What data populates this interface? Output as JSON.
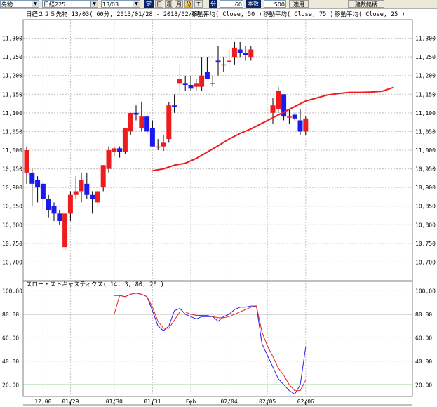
{
  "toolbar": {
    "market": "先物",
    "index": "日経225",
    "contract": "13/03",
    "fixed_label": "定",
    "periods": [
      {
        "label": "日",
        "active": false
      },
      {
        "label": "週",
        "active": false
      },
      {
        "label": "月",
        "active": false
      },
      {
        "label": "分",
        "active": true
      },
      {
        "label": "T",
        "active": false
      }
    ],
    "minute_label": "分",
    "minute_value": "60",
    "count_label": "本数",
    "count_value": "500",
    "apply_label": "適用",
    "brand_button": "建数銘柄"
  },
  "chart_header": {
    "title": "日経２２５先物 13/03( 60分, 2013/01/28 - 2013/02/07 )",
    "ma_labels": [
      "移動平均( Close, 50 )",
      "移動平均( Close, 75 )",
      "移動平均( Close, 25 )"
    ]
  },
  "colors": {
    "up": "#ee1c1c",
    "down": "#1a1aee",
    "ma": "#ee1c1c",
    "grid": "#c0c0c0",
    "stoch_k": "#2222ee",
    "stoch_d": "#ee2222",
    "ref_high": "#999999",
    "ref_low": "#33aa33"
  },
  "chart_data": [
    {
      "type": "candlestick",
      "ylim": [
        10650,
        11350
      ],
      "y_ticks": [
        "11,300",
        "11,250",
        "11,200",
        "11,150",
        "11,100",
        "11,050",
        "11,000",
        "10,950",
        "10,900",
        "10,850",
        "10,800",
        "10,750",
        "10,700"
      ],
      "x_ticks": [
        {
          "label": "12:00",
          "index": 3
        },
        {
          "label": "01/29",
          "index": 8
        },
        {
          "label": "01/30",
          "index": 16
        },
        {
          "label": "01/31",
          "index": 23
        },
        {
          "label": "Feb",
          "index": 30
        },
        {
          "label": "02/04",
          "index": 37
        },
        {
          "label": "02/05",
          "index": 44
        },
        {
          "label": "02/06",
          "index": 51
        }
      ],
      "candles": [
        {
          "o": 10940,
          "h": 11010,
          "l": 10910,
          "c": 11000
        },
        {
          "o": 10940,
          "h": 10950,
          "l": 10850,
          "c": 10910
        },
        {
          "o": 10920,
          "h": 10930,
          "l": 10860,
          "c": 10900
        },
        {
          "o": 10910,
          "h": 10920,
          "l": 10840,
          "c": 10870
        },
        {
          "o": 10870,
          "h": 10880,
          "l": 10820,
          "c": 10840
        },
        {
          "o": 10850,
          "h": 10860,
          "l": 10810,
          "c": 10830
        },
        {
          "o": 10830,
          "h": 10840,
          "l": 10800,
          "c": 10810
        },
        {
          "o": 10740,
          "h": 10830,
          "l": 10730,
          "c": 10830
        },
        {
          "o": 10830,
          "h": 10890,
          "l": 10810,
          "c": 10880
        },
        {
          "o": 10880,
          "h": 10930,
          "l": 10870,
          "c": 10890
        },
        {
          "o": 10890,
          "h": 10940,
          "l": 10860,
          "c": 10920
        },
        {
          "o": 10910,
          "h": 10940,
          "l": 10870,
          "c": 10880
        },
        {
          "o": 10880,
          "h": 10890,
          "l": 10830,
          "c": 10870
        },
        {
          "o": 10860,
          "h": 10890,
          "l": 10850,
          "c": 10890
        },
        {
          "o": 10900,
          "h": 10960,
          "l": 10890,
          "c": 10960
        },
        {
          "o": 10950,
          "h": 11010,
          "l": 10940,
          "c": 11000
        },
        {
          "o": 10995,
          "h": 11010,
          "l": 10985,
          "c": 11005
        },
        {
          "o": 11005,
          "h": 11010,
          "l": 10980,
          "c": 10995
        },
        {
          "o": 10995,
          "h": 11060,
          "l": 10990,
          "c": 11060
        },
        {
          "o": 11050,
          "h": 11100,
          "l": 11040,
          "c": 11100
        },
        {
          "o": 11100,
          "h": 11120,
          "l": 11080,
          "c": 11095
        },
        {
          "o": 11060,
          "h": 11130,
          "l": 11050,
          "c": 11090
        },
        {
          "o": 11090,
          "h": 11100,
          "l": 11040,
          "c": 11050
        },
        {
          "o": 11060,
          "h": 11080,
          "l": 11010,
          "c": 11010
        },
        {
          "o": 11010,
          "h": 11030,
          "l": 11000,
          "c": 11010
        },
        {
          "o": 11010,
          "h": 11040,
          "l": 10998,
          "c": 11020
        },
        {
          "o": 11030,
          "h": 11130,
          "l": 11020,
          "c": 11120
        },
        {
          "o": 11120,
          "h": 11150,
          "l": 11100,
          "c": 11115
        },
        {
          "o": 11180,
          "h": 11230,
          "l": 11150,
          "c": 11190
        },
        {
          "o": 11180,
          "h": 11200,
          "l": 11160,
          "c": 11175
        },
        {
          "o": 11175,
          "h": 11200,
          "l": 11160,
          "c": 11165
        },
        {
          "o": 11170,
          "h": 11190,
          "l": 11160,
          "c": 11180
        },
        {
          "o": 11170,
          "h": 11250,
          "l": 11160,
          "c": 11200
        },
        {
          "o": 11210,
          "h": 11250,
          "l": 11190,
          "c": 11190
        },
        {
          "o": 11180,
          "h": 11200,
          "l": 11170,
          "c": 11180
        },
        {
          "o": 11240,
          "h": 11280,
          "l": 11200,
          "c": 11235
        },
        {
          "o": 11230,
          "h": 11250,
          "l": 11210,
          "c": 11230
        },
        {
          "o": 11240,
          "h": 11270,
          "l": 11230,
          "c": 11240
        },
        {
          "o": 11250,
          "h": 11290,
          "l": 11230,
          "c": 11275
        },
        {
          "o": 11270,
          "h": 11290,
          "l": 11250,
          "c": 11260
        },
        {
          "o": 11260,
          "h": 11280,
          "l": 11240,
          "c": 11255
        },
        {
          "o": 11250,
          "h": 11280,
          "l": 11240,
          "c": 11270
        },
        null,
        null,
        null,
        {
          "o": 11100,
          "h": 11140,
          "l": 11070,
          "c": 11120
        },
        {
          "o": 11110,
          "h": 11170,
          "l": 11100,
          "c": 11160
        },
        {
          "o": 11150,
          "h": 11150,
          "l": 11080,
          "c": 11090
        },
        {
          "o": 11090,
          "h": 11110,
          "l": 11070,
          "c": 11090
        },
        {
          "o": 11095,
          "h": 11100,
          "l": 11080,
          "c": 11085
        },
        {
          "o": 11080,
          "h": 11110,
          "l": 11040,
          "c": 11050
        },
        {
          "o": 11050,
          "h": 11090,
          "l": 11040,
          "c": 11085
        }
      ],
      "moving_average": [
        [
          23,
          10945
        ],
        [
          25,
          10950
        ],
        [
          27,
          10960
        ],
        [
          29,
          10965
        ],
        [
          31,
          10978
        ],
        [
          33,
          10995
        ],
        [
          35,
          11012
        ],
        [
          37,
          11030
        ],
        [
          39,
          11045
        ],
        [
          41,
          11057
        ],
        [
          43,
          11072
        ],
        [
          45,
          11087
        ],
        [
          47,
          11102
        ],
        [
          49,
          11117
        ],
        [
          51,
          11132
        ],
        [
          53,
          11140
        ],
        [
          55,
          11148
        ],
        [
          57,
          11152
        ],
        [
          59,
          11155
        ],
        [
          61,
          11155
        ],
        [
          63,
          11156
        ],
        [
          65,
          11158
        ],
        [
          67,
          11168
        ]
      ]
    },
    {
      "type": "line",
      "title": "スロー・ストキャスティクス( 14, 3, 80, 20 )",
      "ylim": [
        10,
        108
      ],
      "y_ticks": [
        "100.00",
        "80.00",
        "60.00",
        "40.00",
        "20.00"
      ],
      "reference_lines": [
        80,
        20
      ],
      "x": [
        16,
        17,
        18,
        19,
        20,
        21,
        22,
        23,
        24,
        25,
        26,
        27,
        28,
        29,
        30,
        31,
        32,
        33,
        34,
        35,
        36,
        37,
        38,
        39,
        40,
        41,
        42,
        43,
        44,
        45,
        46,
        47,
        48,
        49,
        50,
        51
      ],
      "series": [
        {
          "values": [
            96,
            96,
            95,
            97,
            98,
            97,
            95,
            83,
            70,
            66,
            70,
            83,
            85,
            80,
            78,
            76,
            78,
            78,
            78,
            74,
            78,
            80,
            84,
            86,
            86,
            87,
            87,
            55,
            45,
            35,
            25,
            20,
            15,
            12,
            20,
            52
          ]
        },
        {
          "values": [
            80,
            96,
            95,
            97,
            98,
            97,
            95,
            86,
            74,
            68,
            68,
            75,
            82,
            82,
            80,
            79,
            79,
            79,
            78,
            77,
            77,
            78,
            80,
            82,
            84,
            86,
            87,
            65,
            53,
            44,
            34,
            28,
            20,
            15,
            15,
            24
          ]
        }
      ]
    }
  ]
}
